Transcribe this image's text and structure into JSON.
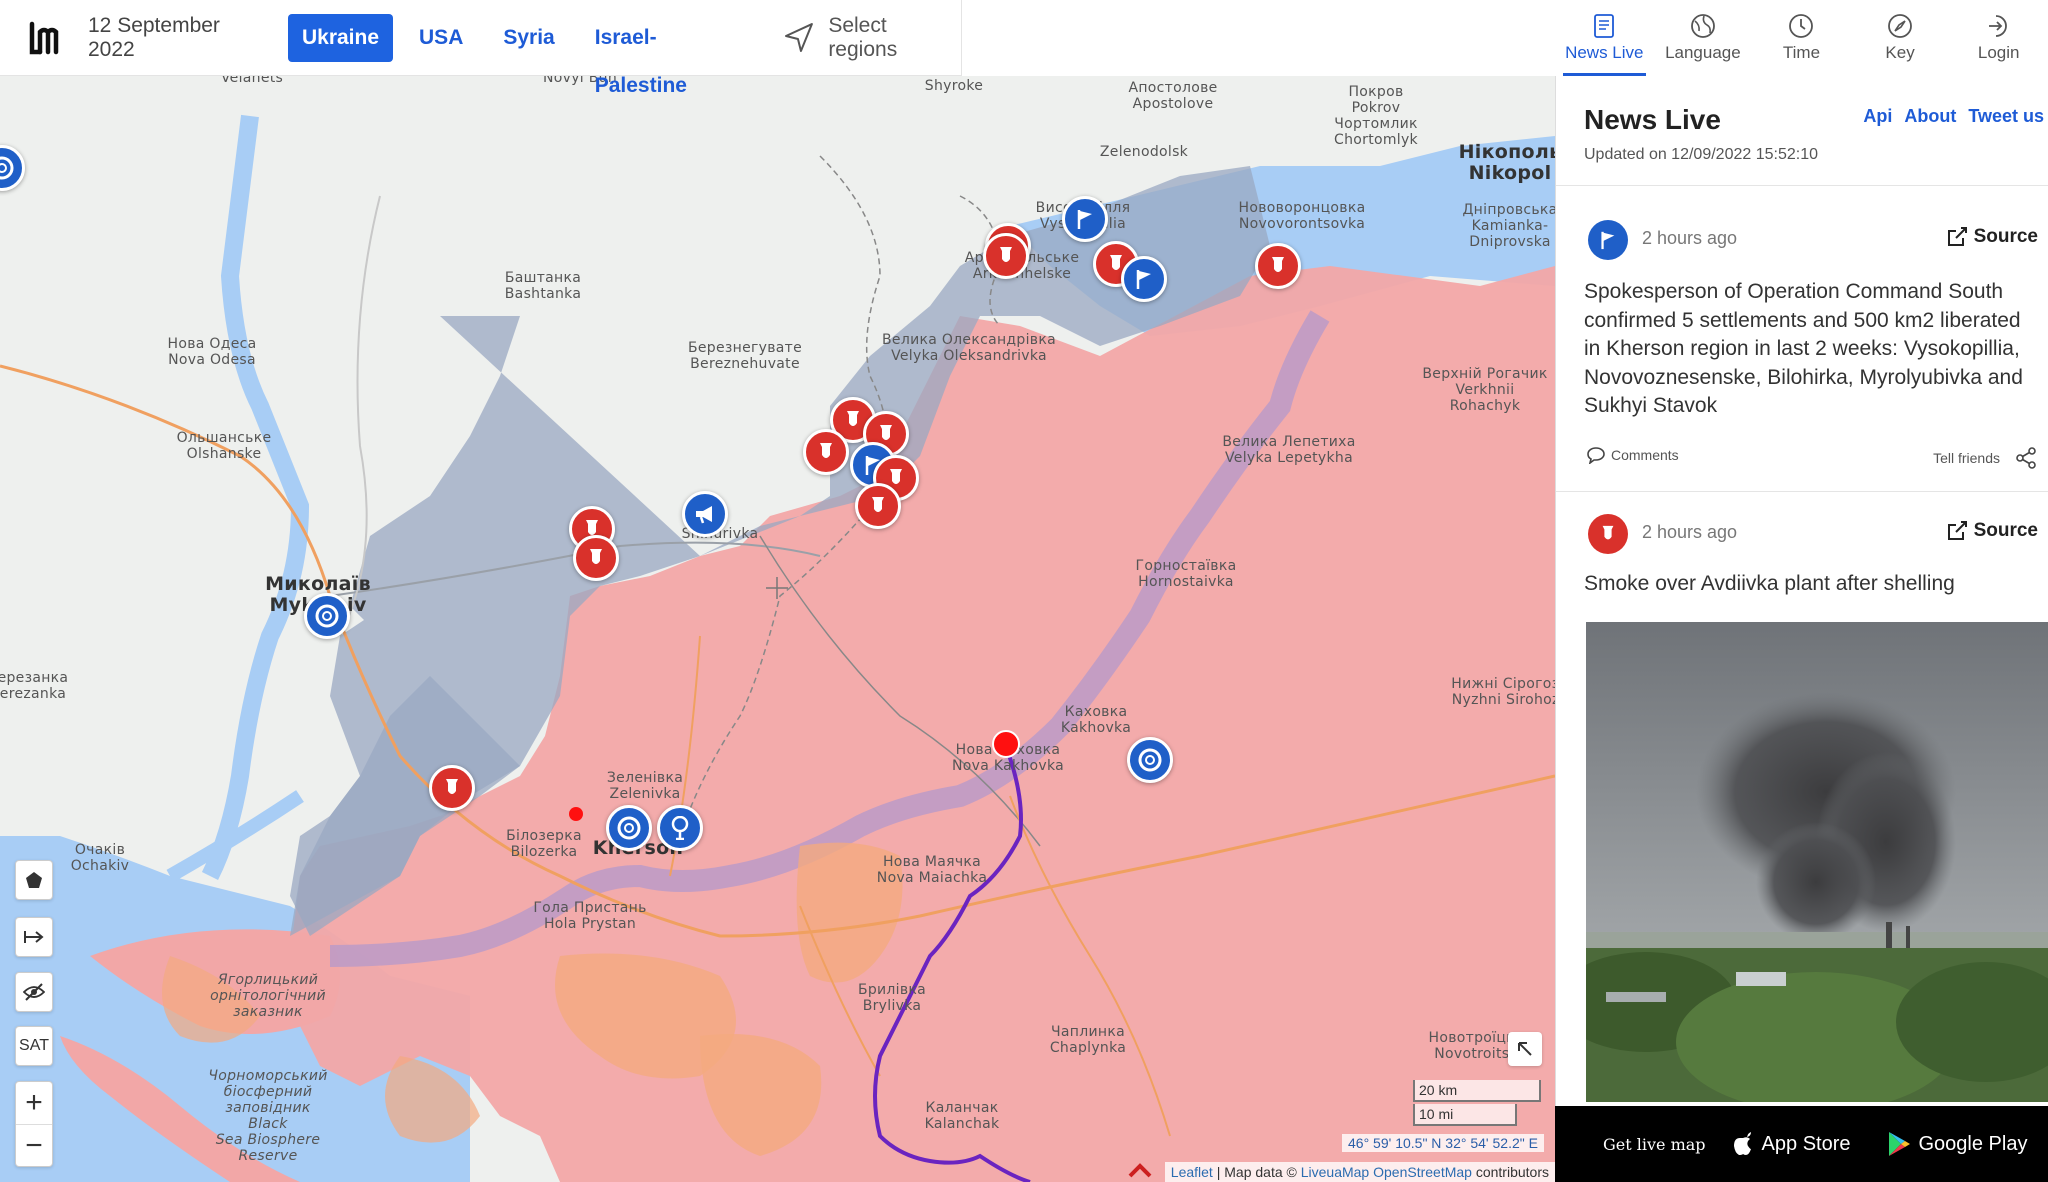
{
  "header": {
    "date": "12 September 2022",
    "tabs": [
      {
        "label": "Ukraine",
        "active": true
      },
      {
        "label": "USA"
      },
      {
        "label": "Syria"
      },
      {
        "label": "Israel-Palestine"
      }
    ],
    "select_regions": "Select regions"
  },
  "right_tabs": [
    {
      "label": "News Live",
      "icon": "news-icon",
      "active": true
    },
    {
      "label": "Language",
      "icon": "language-icon"
    },
    {
      "label": "Time",
      "icon": "clock-icon"
    },
    {
      "label": "Key",
      "icon": "compass-icon"
    },
    {
      "label": "Login",
      "icon": "login-icon"
    }
  ],
  "panel": {
    "title": "News Live",
    "updated": "Updated on 12/09/2022 15:52:10",
    "links": [
      "Api",
      "About",
      "Tweet us"
    ],
    "items": [
      {
        "icon": "flag-icon",
        "icon_color": "#1f5fc8",
        "time": "2 hours ago",
        "source_label": "Source",
        "text": "Spokesperson of Operation Command South confirmed 5 settlements and 500 km2 liberated in Kherson region in last 2 weeks: Vysokopillia, Novovoznesenske, Bilohirka, Myrolyubivka and Sukhyi Stavok",
        "comments_label": "Comments",
        "tell_friends": "Tell friends"
      },
      {
        "icon": "bomb-icon",
        "icon_color": "#d9312b",
        "time": "2 hours ago",
        "source_label": "Source",
        "text": "Smoke over Avdiivka plant after shelling"
      }
    ]
  },
  "map": {
    "places": {
      "velanets": "Velanets",
      "novyi_buh": "Novyi Buh",
      "shyroke": "Shyroke",
      "apostolove_ua": "Апостолове",
      "apostolove": "Apostolove",
      "pokrov_ua": "Покров",
      "pokrov": "Pokrov",
      "chortomlyk_ua": "Чортомлик",
      "chortomlyk": "Chortomlyk",
      "nikopol_ua": "Нікополь",
      "nikopol": "Nikopol",
      "zelenodolsk": "Zelenodolsk",
      "bashtanka_ua": "Баштанка",
      "bashtanka": "Bashtanka",
      "vysokopillia_ua": "Високопілля",
      "vysokopillia": "Vysokopillia",
      "arkhanhelske_ua": "Архангельське",
      "arkhanhelske": "Arkhanhelske",
      "novovorontsovka_ua": "Нововоронцовка",
      "novovorontsovka": "Novovorontsovka",
      "dniprovska_ua": "Дніпровська",
      "kamianka_ua": "Кам'янка-",
      "kamianka": "Kamianka-",
      "dniprovska": "Dniprovska",
      "nova_odesa_ua": "Нова Одеса",
      "nova_odesa": "Nova Odesa",
      "bereznehuvate_ua": "Березнегувате",
      "bereznehuvate": "Bereznehuvate",
      "velyka_oleks_ua": "Велика Олександрівка",
      "velyka_oleks": "Velyka Oleksandrivka",
      "verkhnii_ua": "Верхній Рогачик",
      "verkhnii": "Verkhnii",
      "rohachyk": "Rohachyk",
      "olshanske_ua": "Ольшанське",
      "olshanske": "Olshanske",
      "velyka_lep_ua": "Велика Лепетиха",
      "velyka_lep": "Velyka Lepetykha",
      "snihurivka": "Snihurivka",
      "mykolaiv_ua": "Миколаїв",
      "mykolaiv": "Mykolaiv",
      "hornostaivka_ua": "Горностаївка",
      "hornostaivka": "Hornostaivka",
      "berezanka_ua": "Березанка",
      "berezanka": "Berezanka",
      "kakhovka_ua": "Каховка",
      "kakhovka": "Kakhovka",
      "nyzhni_ua": "Нижні Сірогози",
      "nyzhni": "Nyzhni Sirohozy",
      "nova_kakh_ua": "Нова Каховка",
      "nova_kakh": "Nova Kakhovka",
      "zelenivka_ua": "Зеленівка",
      "zelenivka": "Zelenivka",
      "bilozerka_ua": "Білозерка",
      "bilozerka": "Bilozerka",
      "kherson": "Kherson",
      "ochakiv_ua": "Очаків",
      "ochakiv": "Ochakiv",
      "nova_maiach_ua": "Нова Маячка",
      "nova_maiach": "Nova Maiachka",
      "hola_ua": "Гола Пристань",
      "hola": "Hola Prystan",
      "yahorlyk_ua_1": "Ягорлицький",
      "yahorlyk_ua_2": "орнітологічний",
      "yahorlyk_ua_3": "заказник",
      "brylivka_ua": "Брилівка",
      "brylivka": "Brylivka",
      "chaplynka_ua": "Чаплинка",
      "chaplynka": "Chaplynka",
      "novotroitske_ua": "Новотроїцьк",
      "novotroitske": "Novotroitsk",
      "chorno_ua_1": "Чорноморський",
      "chorno_ua_2": "біосферний",
      "chorno_ua_3": "заповідник",
      "chorno_1": "Black",
      "chorno_2": "Sea Biosphere",
      "chorno_3": "Reserve",
      "kalanchak_ua": "Каланчак",
      "kalanchak": "Kalanchak"
    },
    "controls": {
      "sat": "SAT",
      "zoom_in": "+",
      "zoom_out": "−",
      "scale_km": "20 km",
      "scale_mi": "10 mi"
    },
    "coords": "46° 59' 10.5\" N 32° 54' 52.2\" E",
    "attrib_leaflet": "Leaflet",
    "attrib_sep": " | Map data © ",
    "attrib_lm": "LiveuaMap",
    "attrib_osm": "OpenStreetMap",
    "attrib_tail": " contributors",
    "colors": {
      "occupied": "#f2a7a7",
      "liberated": "#9aa8c2",
      "water": "#a8cdf5",
      "land": "#eef0ee",
      "marker_red": "#d9312b",
      "marker_blue": "#1f5fc8"
    }
  },
  "bottombar": {
    "get_live_map": "Get live map",
    "app_store": "App Store",
    "google_play": "Google Play"
  }
}
